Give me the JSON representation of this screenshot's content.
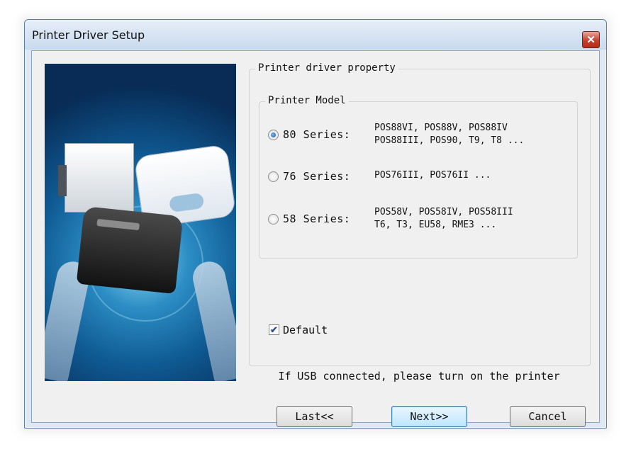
{
  "window": {
    "title": "Printer Driver Setup",
    "close_symbol": "✕"
  },
  "property_group": {
    "legend": "Printer driver property"
  },
  "model_group": {
    "legend": "Printer Model",
    "options": [
      {
        "label": "80 Series:",
        "models_line1": "POS88VI, POS88V, POS88IV",
        "models_line2": "POS88III, POS90, T9, T8 ...",
        "checked": true
      },
      {
        "label": "76 Series:",
        "models_line1": "POS76III, POS76II ...",
        "models_line2": "",
        "checked": false
      },
      {
        "label": "58 Series:",
        "models_line1": "POS58V, POS58IV, POS58III",
        "models_line2": "T6, T3, EU58, RME3 ...",
        "checked": false
      }
    ]
  },
  "default_checkbox": {
    "label": "Default",
    "checked": true,
    "check_symbol": "✔"
  },
  "usb_note": "If USB connected, please turn on the printer",
  "buttons": {
    "last": "Last<<",
    "next": "Next>>",
    "cancel": "Cancel"
  }
}
